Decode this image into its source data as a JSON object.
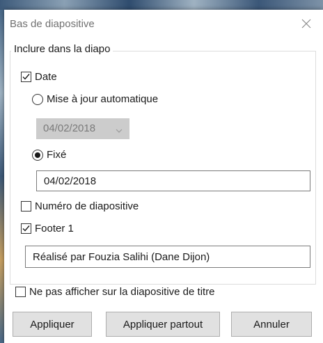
{
  "dialog": {
    "title": "Bas de diapositive",
    "group_label": "Inclure dans la diapo",
    "date": {
      "label": "Date",
      "checked": true
    },
    "auto_update": {
      "label": "Mise à jour automatique",
      "selected": false,
      "date_value": "04/02/2018"
    },
    "fixed": {
      "label": "Fixé",
      "selected": true,
      "value": "04/02/2018"
    },
    "slide_number": {
      "label": "Numéro de diapositive",
      "checked": false
    },
    "footer": {
      "label": "Footer 1",
      "checked": true,
      "value": "Réalisé par Fouzia Salihi (Dane Dijon)"
    },
    "hide_on_title": {
      "label": "Ne pas afficher sur la diapositive de titre",
      "checked": false
    },
    "buttons": {
      "apply": "Appliquer",
      "apply_all": "Appliquer partout",
      "cancel": "Annuler"
    }
  },
  "colors": {
    "button_face": "#e1e1e1",
    "disabled_field": "#cccccc",
    "title_text": "#707070"
  }
}
